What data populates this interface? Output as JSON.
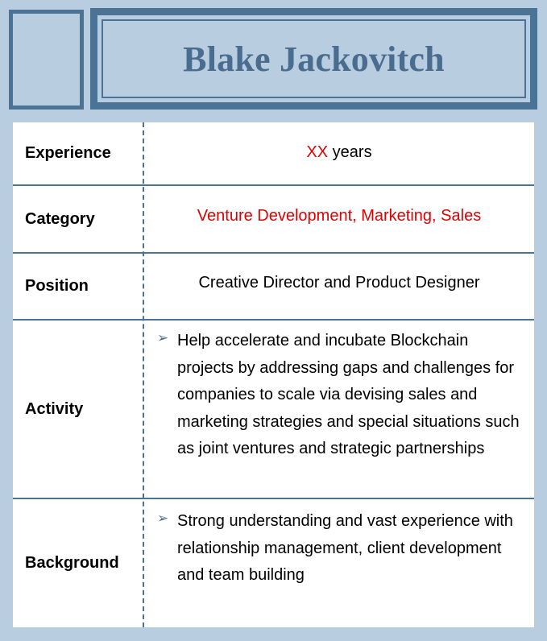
{
  "header": {
    "name": "Blake Jackovitch"
  },
  "rows": {
    "experience": {
      "label": "Experience",
      "value_highlight": "XX",
      "value_rest": " years"
    },
    "category": {
      "label": "Category",
      "value": "Venture Development, Marketing, Sales"
    },
    "position": {
      "label": "Position",
      "value": "Creative Director and Product Designer"
    },
    "activity": {
      "label": "Activity",
      "bullet": "➢",
      "text": "Help accelerate and incubate Blockchain projects by addressing gaps and challenges for companies to scale via devising sales and marketing strategies and special situations such as joint ventures and strategic partnerships"
    },
    "background": {
      "label": "Background",
      "bullet": "➢",
      "text": "Strong understanding and vast experience with relationship management, client development and team building"
    }
  },
  "colors": {
    "page_background": "#b8cde0",
    "frame": "#4a7396",
    "name_text": "#4a6d8f",
    "highlight": "#e00000"
  }
}
